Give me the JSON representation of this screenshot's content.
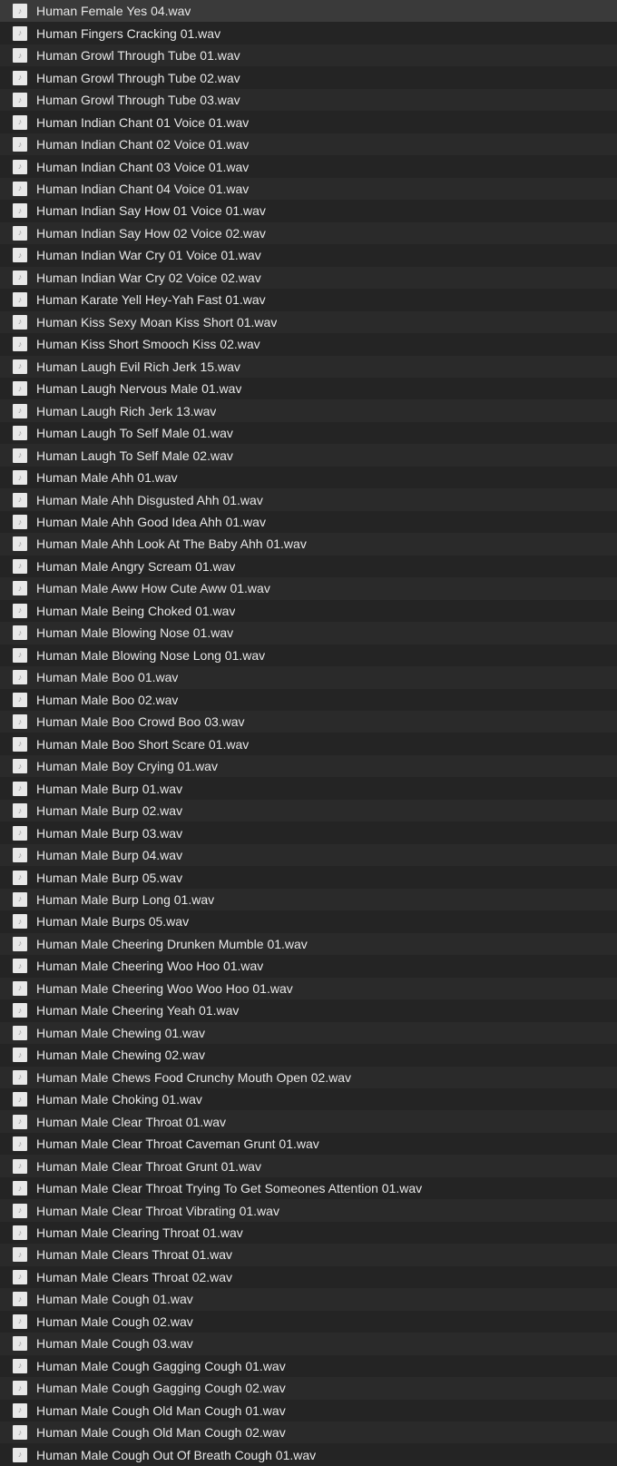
{
  "files": [
    "Human Female Yes 04.wav",
    "Human Fingers Cracking 01.wav",
    "Human Growl Through Tube 01.wav",
    "Human Growl Through Tube 02.wav",
    "Human Growl Through Tube 03.wav",
    "Human Indian Chant 01 Voice 01.wav",
    "Human Indian Chant 02 Voice 01.wav",
    "Human Indian Chant 03 Voice 01.wav",
    "Human Indian Chant 04 Voice 01.wav",
    "Human Indian Say How 01 Voice 01.wav",
    "Human Indian Say How 02 Voice 02.wav",
    "Human Indian War Cry 01 Voice 01.wav",
    "Human Indian War Cry 02 Voice 02.wav",
    "Human Karate Yell Hey-Yah Fast 01.wav",
    "Human Kiss Sexy Moan Kiss Short 01.wav",
    "Human Kiss Short Smooch Kiss 02.wav",
    "Human Laugh Evil Rich Jerk 15.wav",
    "Human Laugh Nervous Male 01.wav",
    "Human Laugh Rich Jerk 13.wav",
    "Human Laugh To Self Male 01.wav",
    "Human Laugh To Self Male 02.wav",
    "Human Male Ahh 01.wav",
    "Human Male Ahh Disgusted Ahh 01.wav",
    "Human Male Ahh Good Idea Ahh 01.wav",
    "Human Male Ahh Look At The Baby Ahh 01.wav",
    "Human Male Angry Scream 01.wav",
    "Human Male Aww How Cute Aww 01.wav",
    "Human Male Being Choked 01.wav",
    "Human Male Blowing Nose 01.wav",
    "Human Male Blowing Nose Long 01.wav",
    "Human Male Boo 01.wav",
    "Human Male Boo 02.wav",
    "Human Male Boo Crowd Boo 03.wav",
    "Human Male Boo Short Scare 01.wav",
    "Human Male Boy Crying 01.wav",
    "Human Male Burp 01.wav",
    "Human Male Burp 02.wav",
    "Human Male Burp 03.wav",
    "Human Male Burp 04.wav",
    "Human Male Burp 05.wav",
    "Human Male Burp Long 01.wav",
    "Human Male Burps 05.wav",
    "Human Male Cheering Drunken Mumble 01.wav",
    "Human Male Cheering Woo Hoo 01.wav",
    "Human Male Cheering Woo Woo Hoo 01.wav",
    "Human Male Cheering Yeah 01.wav",
    "Human Male Chewing 01.wav",
    "Human Male Chewing 02.wav",
    "Human Male Chews Food Crunchy Mouth Open 02.wav",
    "Human Male Choking 01.wav",
    "Human Male Clear Throat 01.wav",
    "Human Male Clear Throat Caveman Grunt 01.wav",
    "Human Male Clear Throat Grunt 01.wav",
    "Human Male Clear Throat Trying To Get Someones Attention 01.wav",
    "Human Male Clear Throat Vibrating 01.wav",
    "Human Male Clearing Throat 01.wav",
    "Human Male Clears Throat 01.wav",
    "Human Male Clears Throat 02.wav",
    "Human Male Cough 01.wav",
    "Human Male Cough 02.wav",
    "Human Male Cough 03.wav",
    "Human Male Cough Gagging Cough 01.wav",
    "Human Male Cough Gagging Cough 02.wav",
    "Human Male Cough Old Man Cough 01.wav",
    "Human Male Cough Old Man Cough 02.wav",
    "Human Male Cough Out Of Breath Cough 01.wav"
  ]
}
